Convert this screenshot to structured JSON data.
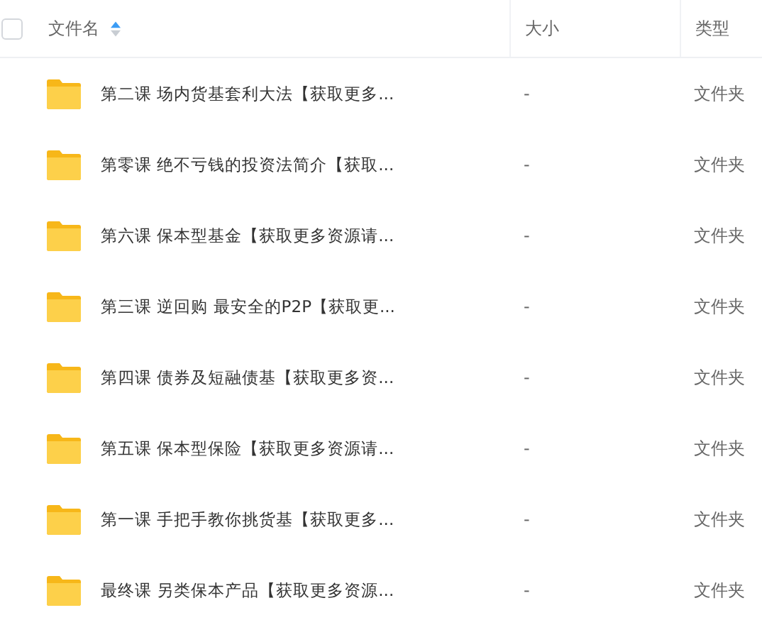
{
  "header": {
    "select_all": {
      "checked": false
    },
    "columns": [
      {
        "label": "文件名",
        "sorted": true,
        "descending": false
      },
      {
        "label": "大小"
      },
      {
        "label": "类型"
      }
    ]
  },
  "files": [
    {
      "kind": "folder",
      "name": "第二课 场内货基套利大法【获取更多...",
      "size": "-",
      "type": "文件夹"
    },
    {
      "kind": "folder",
      "name": "第零课 绝不亏钱的投资法简介【获取...",
      "size": "-",
      "type": "文件夹"
    },
    {
      "kind": "folder",
      "name": "第六课 保本型基金【获取更多资源请...",
      "size": "-",
      "type": "文件夹"
    },
    {
      "kind": "folder",
      "name": "第三课 逆回购 最安全的P2P【获取更...",
      "size": "-",
      "type": "文件夹"
    },
    {
      "kind": "folder",
      "name": "第四课 债券及短融债基【获取更多资...",
      "size": "-",
      "type": "文件夹"
    },
    {
      "kind": "folder",
      "name": "第五课 保本型保险【获取更多资源请...",
      "size": "-",
      "type": "文件夹"
    },
    {
      "kind": "folder",
      "name": "第一课 手把手教你挑货基【获取更多...",
      "size": "-",
      "type": "文件夹"
    },
    {
      "kind": "folder",
      "name": "最终课 另类保本产品【获取更多资源...",
      "size": "-",
      "type": "文件夹"
    }
  ]
}
